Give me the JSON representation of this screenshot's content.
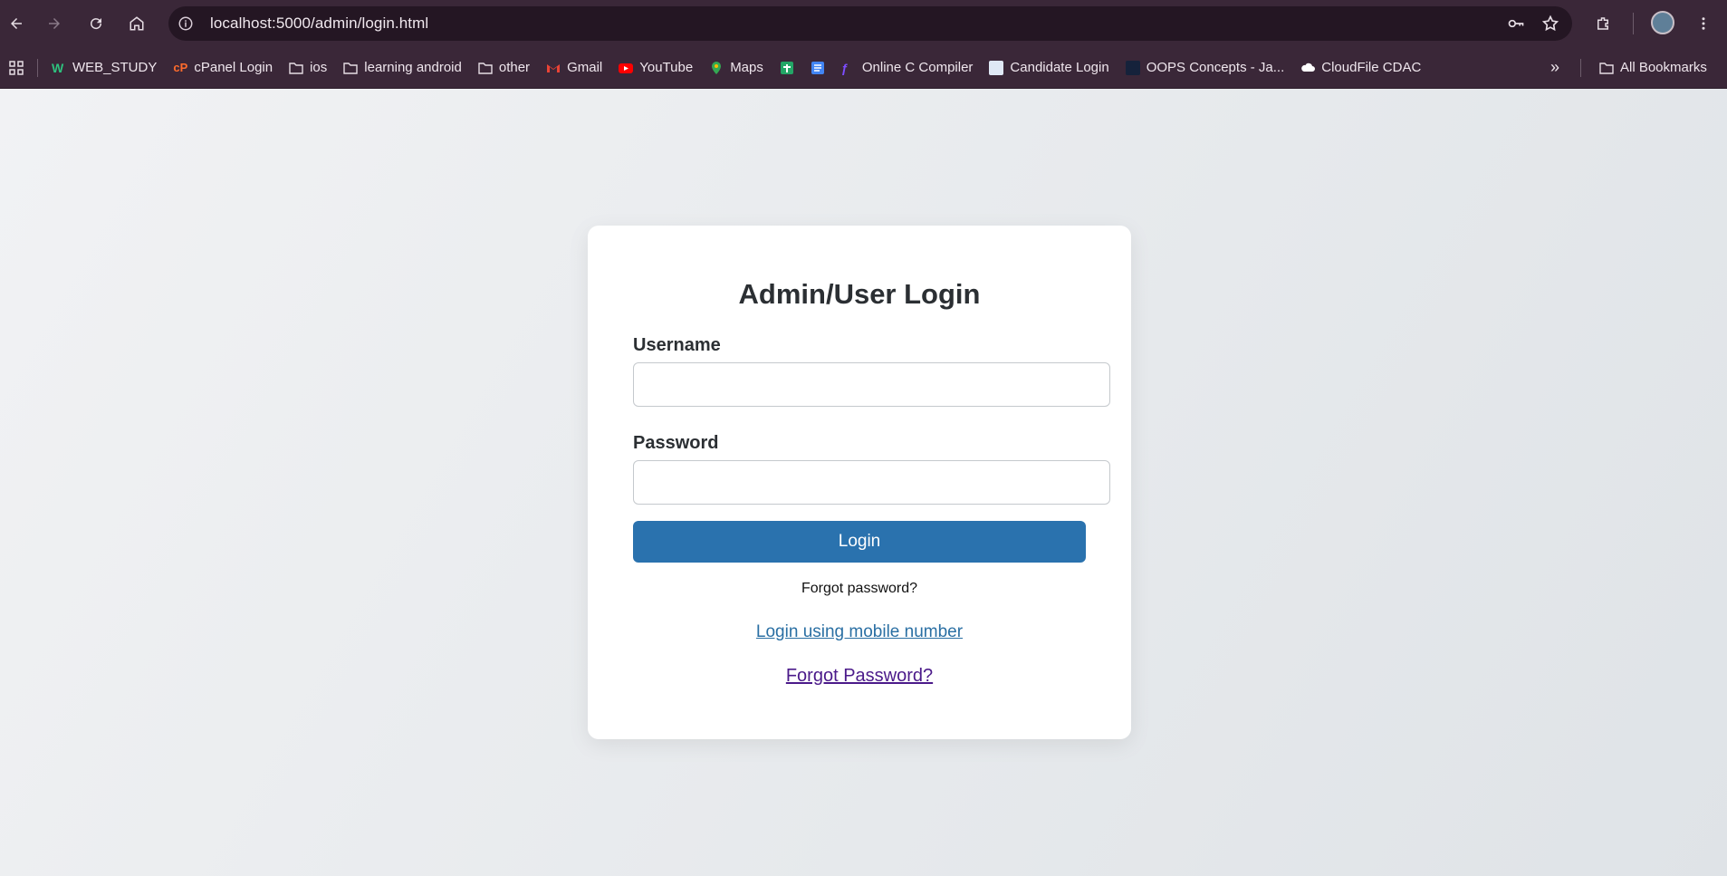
{
  "browser": {
    "url": "localhost:5000/admin/login.html",
    "bookmarks": [
      {
        "label": "WEB_STUDY",
        "icon": "w-logo-icon"
      },
      {
        "label": "cPanel Login",
        "icon": "cpanel-icon"
      },
      {
        "label": "ios",
        "icon": "folder-icon"
      },
      {
        "label": "learning android",
        "icon": "folder-icon"
      },
      {
        "label": "other",
        "icon": "folder-icon"
      },
      {
        "label": "Gmail",
        "icon": "gmail-icon"
      },
      {
        "label": "YouTube",
        "icon": "youtube-icon"
      },
      {
        "label": "Maps",
        "icon": "maps-icon"
      },
      {
        "label": "",
        "icon": "sheets-icon"
      },
      {
        "label": "",
        "icon": "docs-icon"
      },
      {
        "label": "Online C Compiler",
        "icon": "compiler-icon"
      },
      {
        "label": "Candidate Login",
        "icon": "candidate-icon"
      },
      {
        "label": "OOPS Concepts - Ja...",
        "icon": "oops-icon"
      },
      {
        "label": "CloudFile CDAC",
        "icon": "cloud-icon"
      }
    ],
    "all_bookmarks": "All Bookmarks",
    "colors": {
      "chrome": "#3a2738",
      "omnibox": "#241623"
    }
  },
  "login": {
    "title": "Admin/User Login",
    "username_label": "Username",
    "username_value": "",
    "password_label": "Password",
    "password_value": "",
    "login_button": "Login",
    "forgot_plain": "Forgot password?",
    "mobile_link": "Login using mobile number",
    "forgot_link": "Forgot Password?",
    "colors": {
      "button": "#2a72ae",
      "link": "#2a6fa3",
      "visited_link": "#4b1a8a"
    }
  }
}
